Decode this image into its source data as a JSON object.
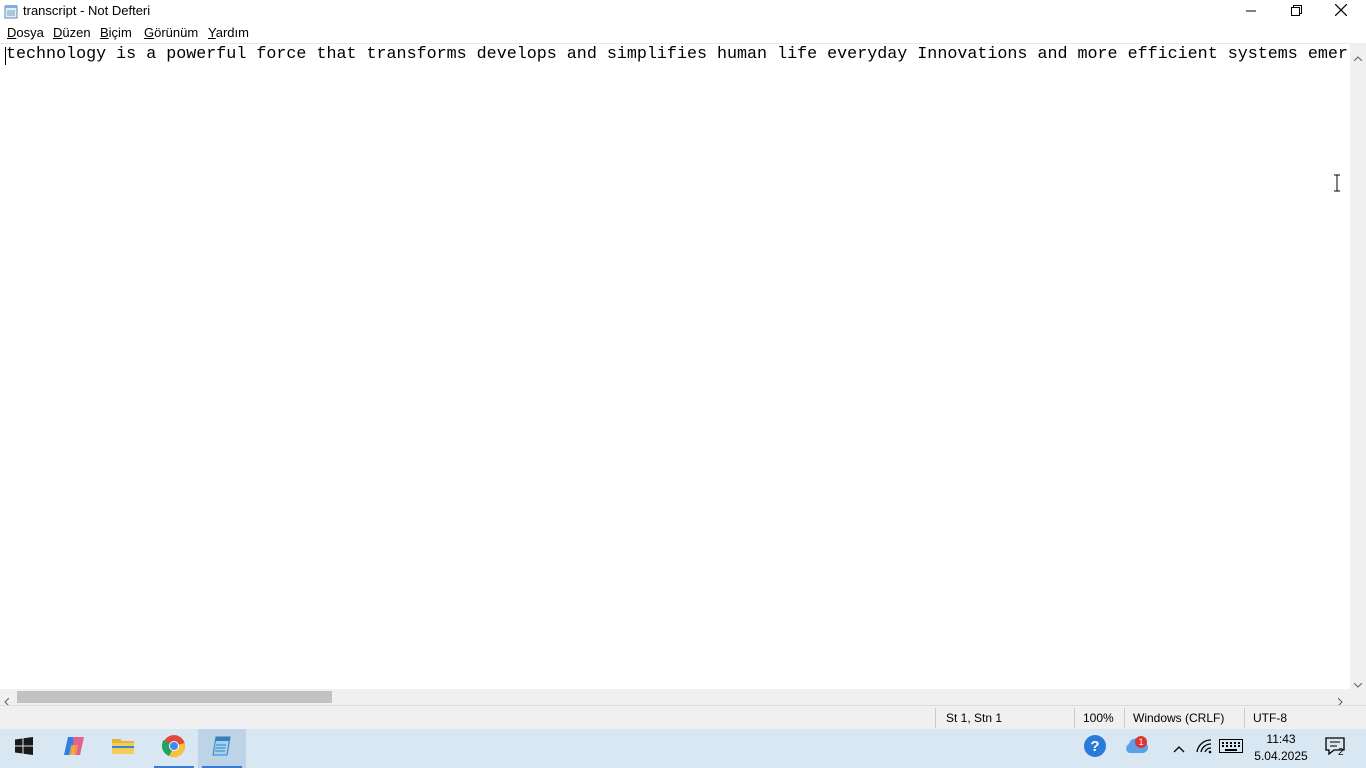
{
  "window": {
    "title": "transcript - Not Defteri",
    "minimize_icon": "minimize-icon",
    "maximize_icon": "restore-icon",
    "close_icon": "close-icon"
  },
  "menu": {
    "items": [
      {
        "accel": "D",
        "rest": "osya"
      },
      {
        "accel": "D",
        "rest": "üzen"
      },
      {
        "accel": "B",
        "rest": "içim"
      },
      {
        "accel": "G",
        "rest": "örünüm"
      },
      {
        "accel": "Y",
        "rest": "ardım"
      }
    ]
  },
  "editor": {
    "content": "technology is a powerful force that transforms develops and simplifies human life everyday Innovations and more efficient systems emer"
  },
  "status": {
    "position": "St 1, Stn 1",
    "zoom": "100%",
    "line_ending": "Windows (CRLF)",
    "encoding": "UTF-8"
  },
  "taskbar": {
    "apps": [
      "start-icon",
      "copilot-icon",
      "file-explorer-icon",
      "chrome-icon",
      "notepad-icon"
    ],
    "weather_badge": "1",
    "clock_time": "11:43",
    "clock_date": "5.04.2025",
    "notification_count": "2"
  },
  "colors": {
    "taskbar": "#d9e7f3",
    "statusbar": "#f0f0f0",
    "accent": "#3a7bd5"
  }
}
